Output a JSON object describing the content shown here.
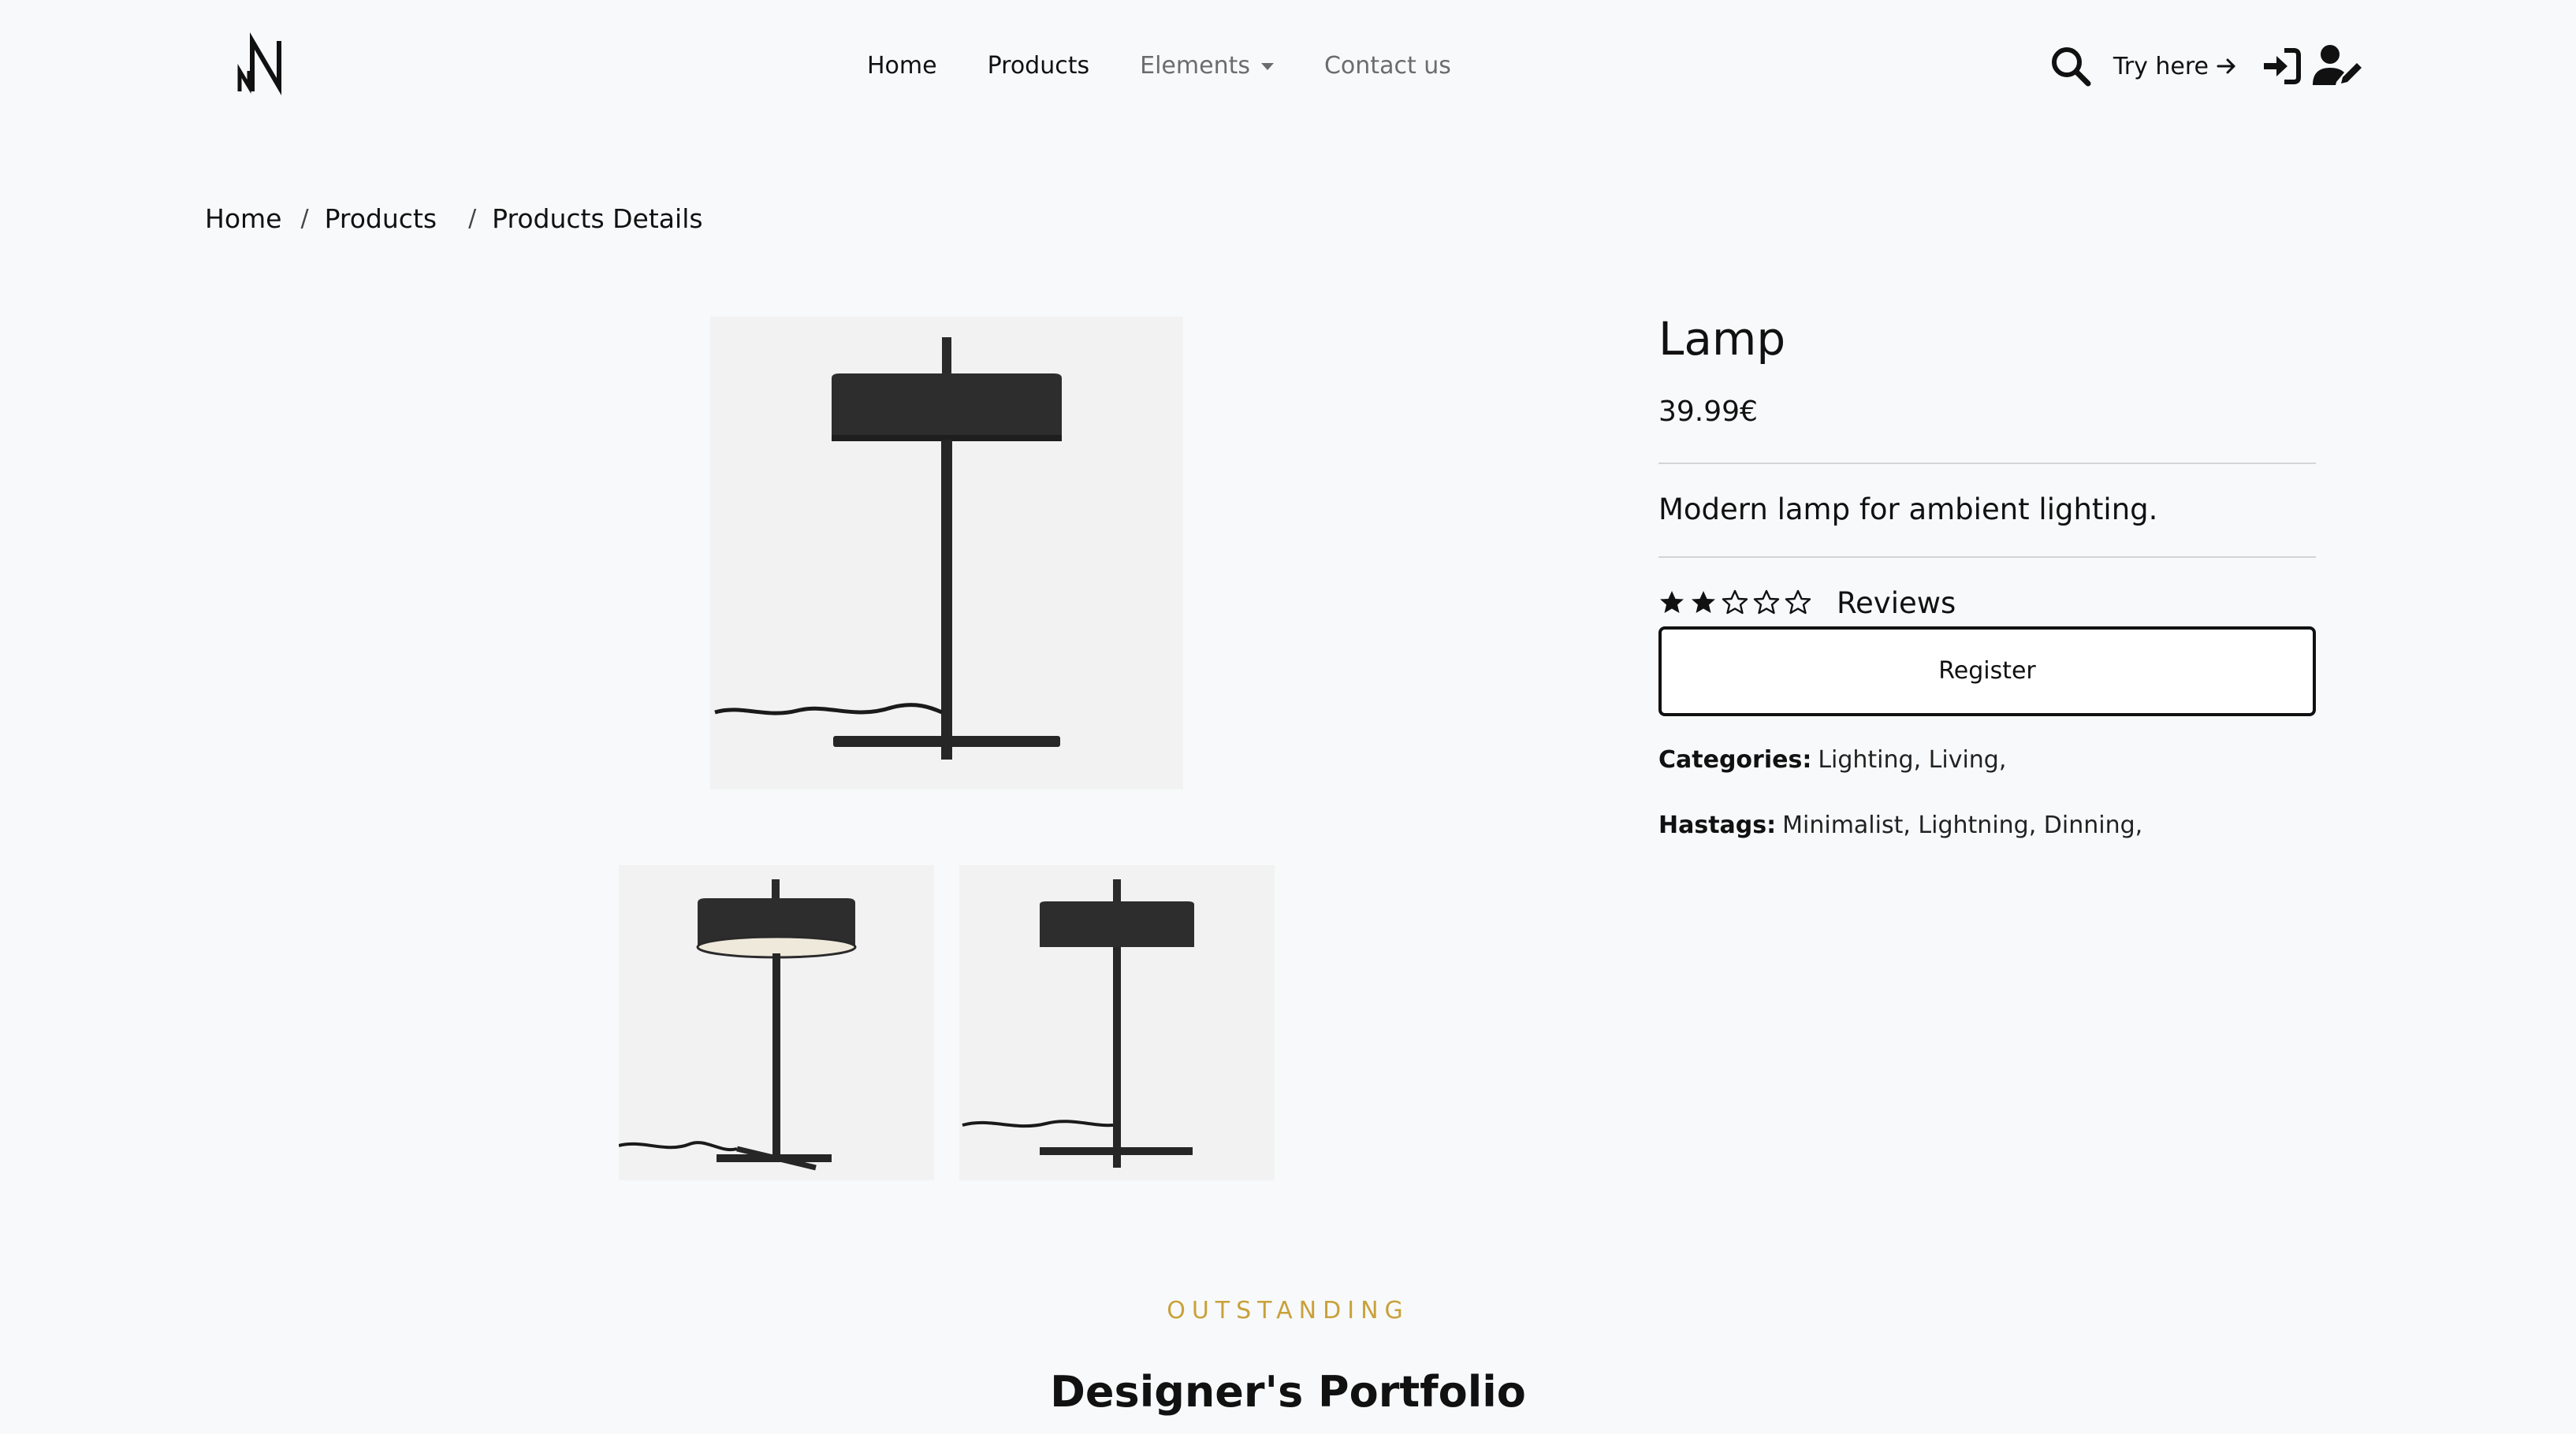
{
  "nav": {
    "logo_alt": "NN",
    "links": [
      {
        "label": "Home"
      },
      {
        "label": "Products"
      },
      {
        "label": "Elements"
      },
      {
        "label": "Contact us"
      }
    ],
    "try_here": "Try here"
  },
  "breadcrumb": [
    "Home",
    "Products",
    "Products Details"
  ],
  "product": {
    "title": "Lamp",
    "price": "39.99€",
    "description": "Modern lamp for ambient lighting.",
    "rating": 2,
    "rating_max": 5,
    "reviews_label": "Reviews",
    "register_label": "Register",
    "categories_label": "Categories:",
    "categories": "Lighting, Living,",
    "hashtags_label": "Hastags:",
    "hashtags": "Minimalist, Lightning, Dinning,"
  },
  "section": {
    "eyebrow": "OUTSTANDING",
    "title": "Designer's Portfolio"
  },
  "colors": {
    "background": "#f8f9fa",
    "accent": "#c8a13a",
    "text": "#111111"
  },
  "icons": [
    "logo-icon",
    "search-icon",
    "arrow-right-icon",
    "sign-in-icon",
    "user-edit-icon",
    "star-filled-icon",
    "star-outline-icon"
  ]
}
